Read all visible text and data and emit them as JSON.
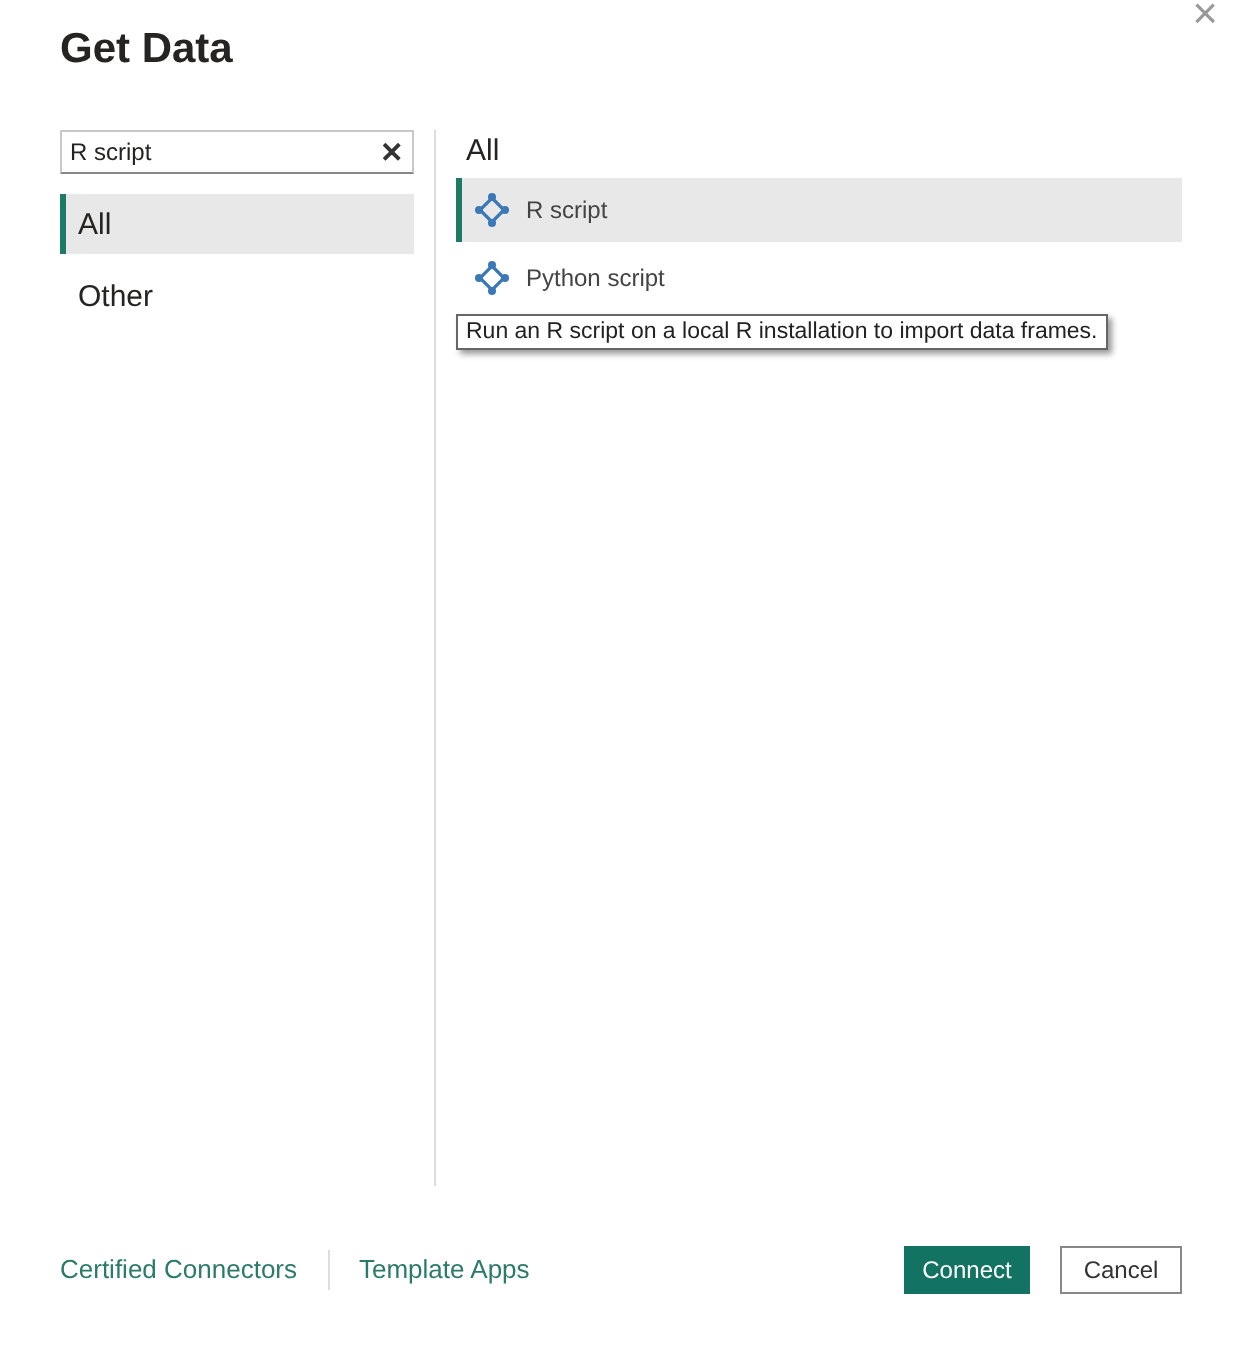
{
  "window": {
    "title": "Get Data",
    "close": "×"
  },
  "search": {
    "value": "R script",
    "clear": "✕"
  },
  "categories": [
    {
      "label": "All",
      "selected": true
    },
    {
      "label": "Other",
      "selected": false
    }
  ],
  "results": {
    "heading": "All",
    "items": [
      {
        "label": "R script",
        "selected": true
      },
      {
        "label": "Python script",
        "selected": false
      }
    ]
  },
  "tooltip": "Run an R script on a local R installation to import data frames.",
  "footer": {
    "links": [
      "Certified Connectors",
      "Template Apps"
    ],
    "buttons": [
      {
        "label": "Connect",
        "kind": "primary"
      },
      {
        "label": "Cancel",
        "kind": "secondary"
      }
    ]
  }
}
